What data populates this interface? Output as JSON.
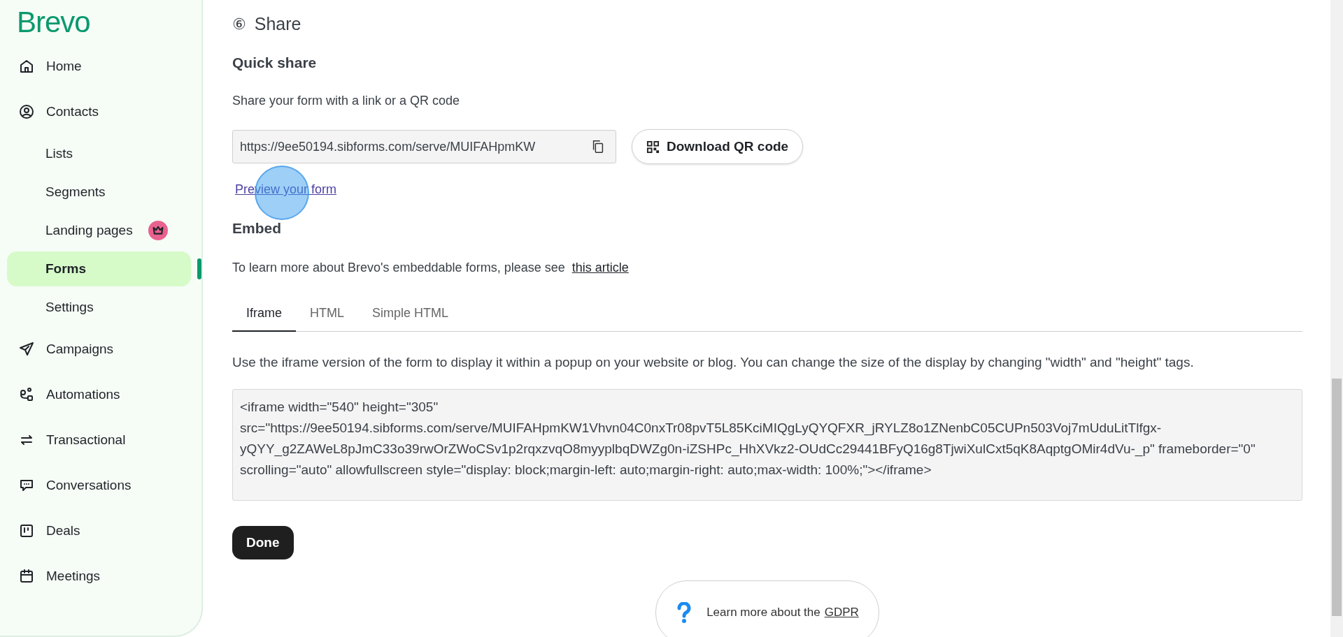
{
  "sidebar": {
    "logo": "Brevo",
    "items": [
      {
        "label": "Home",
        "selected": false
      },
      {
        "label": "Contacts",
        "selected": false,
        "children": [
          {
            "label": "Lists",
            "selected": false,
            "premium": false
          },
          {
            "label": "Segments",
            "selected": false,
            "premium": false
          },
          {
            "label": "Landing pages",
            "selected": false,
            "premium": true
          },
          {
            "label": "Forms",
            "selected": true,
            "premium": false
          },
          {
            "label": "Settings",
            "selected": false,
            "premium": false
          }
        ]
      },
      {
        "label": "Campaigns",
        "selected": false
      },
      {
        "label": "Automations",
        "selected": false
      },
      {
        "label": "Transactional",
        "selected": false
      },
      {
        "label": "Conversations",
        "selected": false
      },
      {
        "label": "Deals",
        "selected": false
      },
      {
        "label": "Meetings",
        "selected": false
      }
    ]
  },
  "share": {
    "step": "⑥",
    "title": "Share",
    "quick_share": {
      "title": "Quick share",
      "text": "Share your form with a link or a QR code",
      "url": "https://9ee50194.sibforms.com/serve/MUIFAHpmKW",
      "qr_button": "Download QR code",
      "preview_link": "Preview your form"
    },
    "embed": {
      "title": "Embed",
      "text": "To learn more about Brevo's embeddable forms, please see",
      "link": "this article",
      "tabs": [
        {
          "label": "Iframe",
          "selected": true
        },
        {
          "label": "HTML",
          "selected": false
        },
        {
          "label": "Simple HTML",
          "selected": false
        }
      ],
      "description": "Use the iframe version of the form to display it within a popup on your website or blog. You can change the size of the display by changing \"width\" and \"height\" tags.",
      "code": "<iframe width=\"540\" height=\"305\" src=\"https://9ee50194.sibforms.com/serve/MUIFAHpmKW1Vhvn04C0nxTr08pvT5L85KciMIQgLyQYQFXR_jRYLZ8o1ZNenbC05CUPn503Voj7mUduLitTlfgx-yQYY_g2ZAWeL8pJmC33o39rwOrZWoCSv1p2rqxzvqO8myyplbqDWZg0n-iZSHPc_HhXVkz2-OUdCc29441BFyQ16g8TjwiXulCxt5qK8AqptgOMir4dVu-_p\" frameborder=\"0\" scrolling=\"auto\" allowfullscreen style=\"display: block;margin-left: auto;margin-right: auto;max-width: 100%;\"></iframe>"
    },
    "done_button": "Done"
  },
  "help": {
    "text": "Learn more about the",
    "link": "GDPR"
  }
}
